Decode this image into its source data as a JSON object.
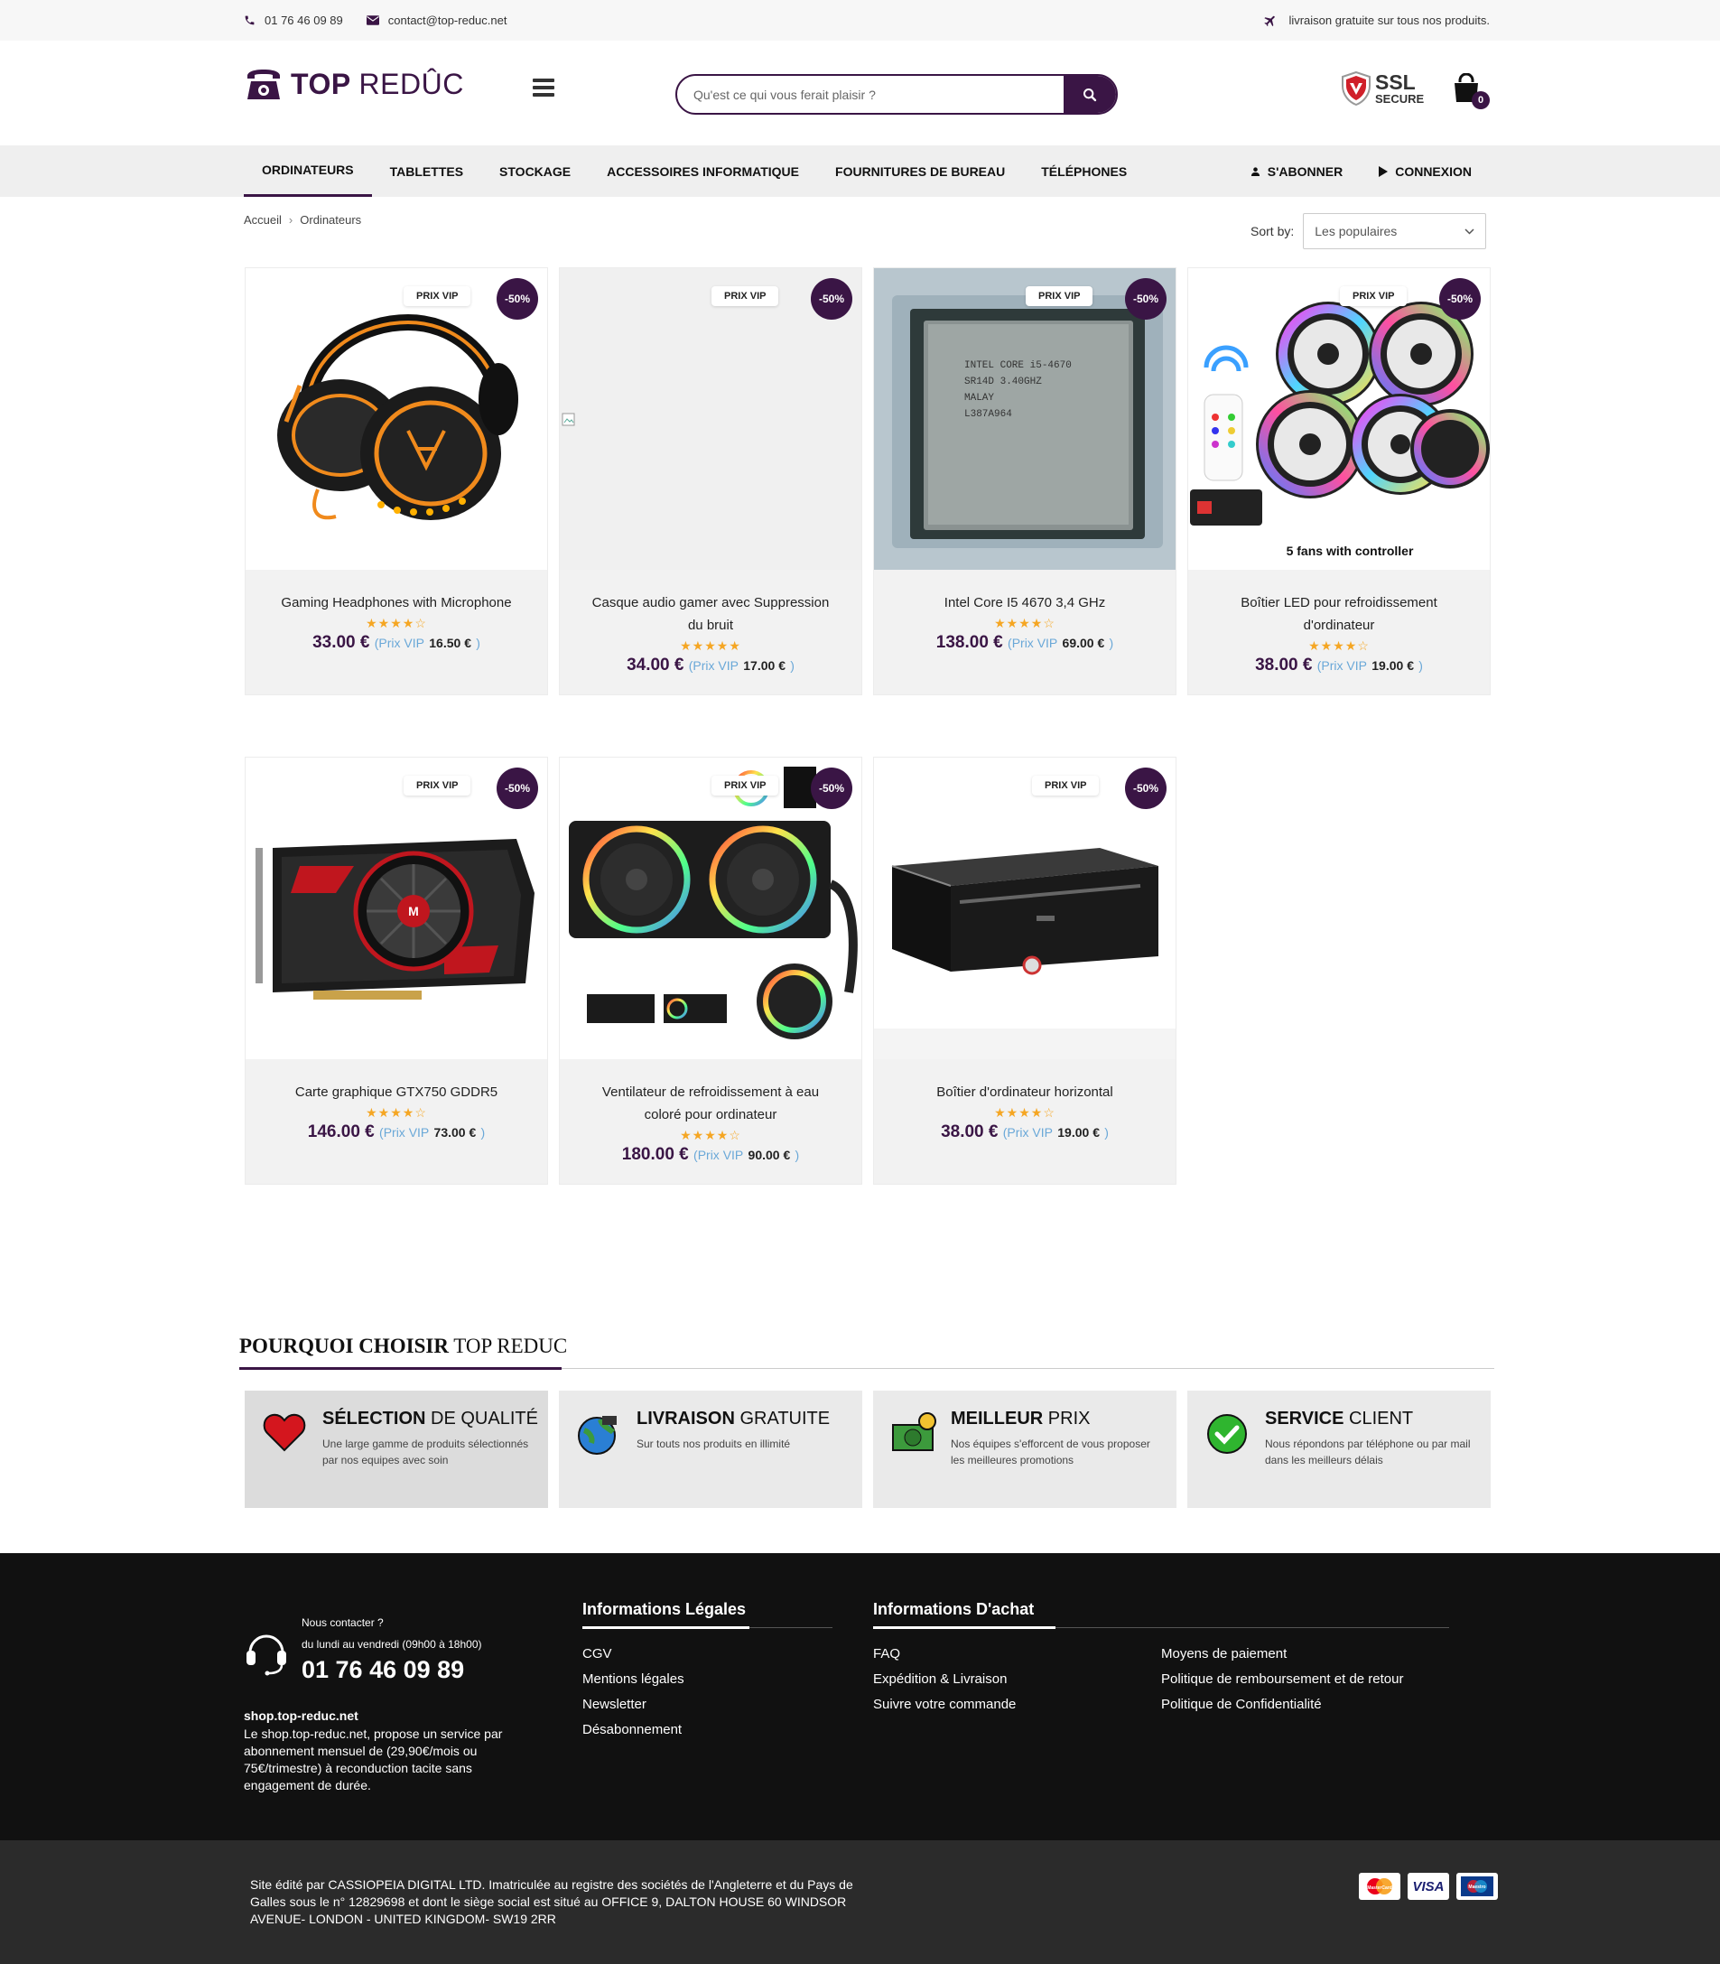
{
  "topbar": {
    "phone": "01 76 46 09 89",
    "email": "contact@top-reduc.net",
    "shipping_note": "livraison gratuite sur tous nos produits."
  },
  "header": {
    "logo_bold": "TOP",
    "logo_light": "REDÛC",
    "search_placeholder": "Qu'est ce qui vous ferait plaisir ?",
    "ssl_big": "SSL",
    "ssl_small": "SECURE",
    "cart_count": "0"
  },
  "nav": {
    "items": [
      "Ordinateurs",
      "Tablettes",
      "Stockage",
      "Accessoires informatique",
      "Fournitures de bureau",
      "Téléphones"
    ],
    "subscribe": "S'abonner",
    "login": "Connexion"
  },
  "breadcrumb": {
    "home": "Accueil",
    "current": "Ordinateurs"
  },
  "sort": {
    "label": "Sort by:",
    "selected": "Les populaires"
  },
  "product_labels": {
    "vip_tag": "PRIX VIP",
    "discount": "-50%",
    "vip_prefix": "(Prix VIP",
    "vip_suffix": ")"
  },
  "products": [
    {
      "name": "Gaming Headphones with Microphone",
      "price": "33.00 €",
      "vip_price": "16.50 €",
      "stars": "★★★★☆"
    },
    {
      "name": "Casque audio gamer avec Suppression du bruit",
      "price": "34.00 €",
      "vip_price": "17.00 €",
      "stars": "★★★★★"
    },
    {
      "name": "Intel Core I5 4670 3,4 GHz",
      "price": "138.00 €",
      "vip_price": "69.00 €",
      "stars": "★★★★☆"
    },
    {
      "name": "Boîtier LED pour refroidissement d'ordinateur",
      "price": "38.00 €",
      "vip_price": "19.00 €",
      "stars": "★★★★☆"
    },
    {
      "name": "Carte graphique GTX750 GDDR5",
      "price": "146.00 €",
      "vip_price": "73.00 €",
      "stars": "★★★★☆"
    },
    {
      "name": "Ventilateur de refroidissement à eau coloré pour ordinateur",
      "price": "180.00 €",
      "vip_price": "90.00 €",
      "stars": "★★★★☆"
    },
    {
      "name": "Boîtier d'ordinateur horizontal",
      "price": "38.00 €",
      "vip_price": "19.00 €",
      "stars": "★★★★☆"
    }
  ],
  "image_text": {
    "fans_caption": "5 fans with controller"
  },
  "why": {
    "title_bold": "POURQUOI CHOISIR",
    "title_light": "TOP REDUC",
    "features": [
      {
        "bold": "SÉLECTION",
        "light": "DE QUALITÉ",
        "desc": "Une large gamme de produits sélectionnés par nos equipes avec soin",
        "icon": "heart-icon"
      },
      {
        "bold": "LIVRAISON",
        "light": "GRATUITE",
        "desc": "Sur touts nos produits en illimité",
        "icon": "globe-cart-icon"
      },
      {
        "bold": "MEILLEUR",
        "light": "PRIX",
        "desc": "Nos équipes s'efforcent de vous proposer les meilleures promotions",
        "icon": "money-icon"
      },
      {
        "bold": "SERVICE",
        "light": "CLIENT",
        "desc": "Nous répondons par téléphone ou par mail dans les meilleurs délais",
        "icon": "check-icon"
      }
    ]
  },
  "footer": {
    "contact_ask": "Nous contacter ?",
    "contact_hours": "du lundi au vendredi (09h00 à 18h00)",
    "contact_phone": "01 76 46 09 89",
    "shop_name": "shop.top-reduc.net",
    "shop_desc": "Le shop.top-reduc.net, propose un service par abonnement mensuel de (29,90€/mois ou 75€/trimestre) à reconduction tacite sans engagement de durée.",
    "legal_title": "Informations Légales",
    "legal_links": [
      "CGV",
      "Mentions légales",
      "Newsletter",
      "Désabonnement"
    ],
    "purchase_title": "Informations D'achat",
    "purchase_links_a": [
      "FAQ",
      "Expédition & Livraison",
      "Suivre votre commande"
    ],
    "purchase_links_b": [
      "Moyens de paiement",
      "Politique de remboursement et de retour",
      "Politique de Confidentialité"
    ]
  },
  "bottom": {
    "legal_text": "Site édité par CASSIOPEIA DIGITAL LTD. Imatriculée au registre des sociétés de l'Angleterre et du Pays de Galles sous le n° 12829698 et dont le siège social est situé au OFFICE 9, DALTON HOUSE 60 WINDSOR AVENUE- LONDON - UNITED KINGDOM- SW19 2RR",
    "payments": [
      "MasterCard",
      "VISA",
      "Maestro"
    ]
  },
  "colors": {
    "brand": "#3a1545",
    "vip": "#6aa8d8",
    "stars": "#f5a623"
  }
}
